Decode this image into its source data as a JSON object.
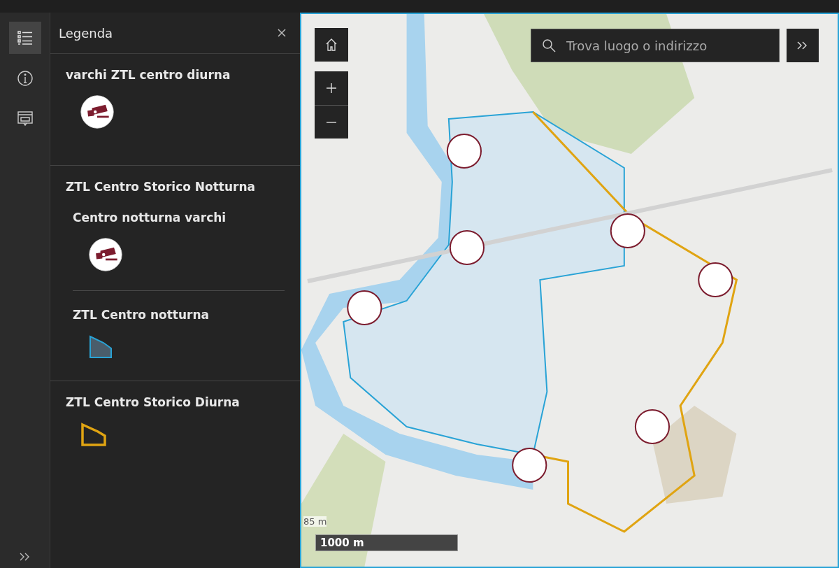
{
  "rail": {
    "items": [
      {
        "kind": "legend",
        "selected": true
      },
      {
        "kind": "info",
        "selected": false
      },
      {
        "kind": "popup",
        "selected": false
      }
    ]
  },
  "panel": {
    "title": "Legenda",
    "sections": [
      {
        "title": "varchi ZTL centro diurna",
        "kind": "camera"
      },
      {
        "title": "ZTL Centro Storico Notturna",
        "sublayers": [
          {
            "title": "Centro notturna varchi",
            "kind": "camera"
          },
          {
            "title": "ZTL Centro notturna",
            "kind": "area",
            "color": "#29a3d6"
          }
        ]
      },
      {
        "title": "ZTL Centro Storico Diurna",
        "kind": "outline",
        "color": "#e0a412"
      }
    ]
  },
  "map": {
    "search": {
      "placeholder": "Trova luogo o indirizzo"
    },
    "scale": {
      "label": "1000 m",
      "secondary_label": "85 m"
    }
  }
}
